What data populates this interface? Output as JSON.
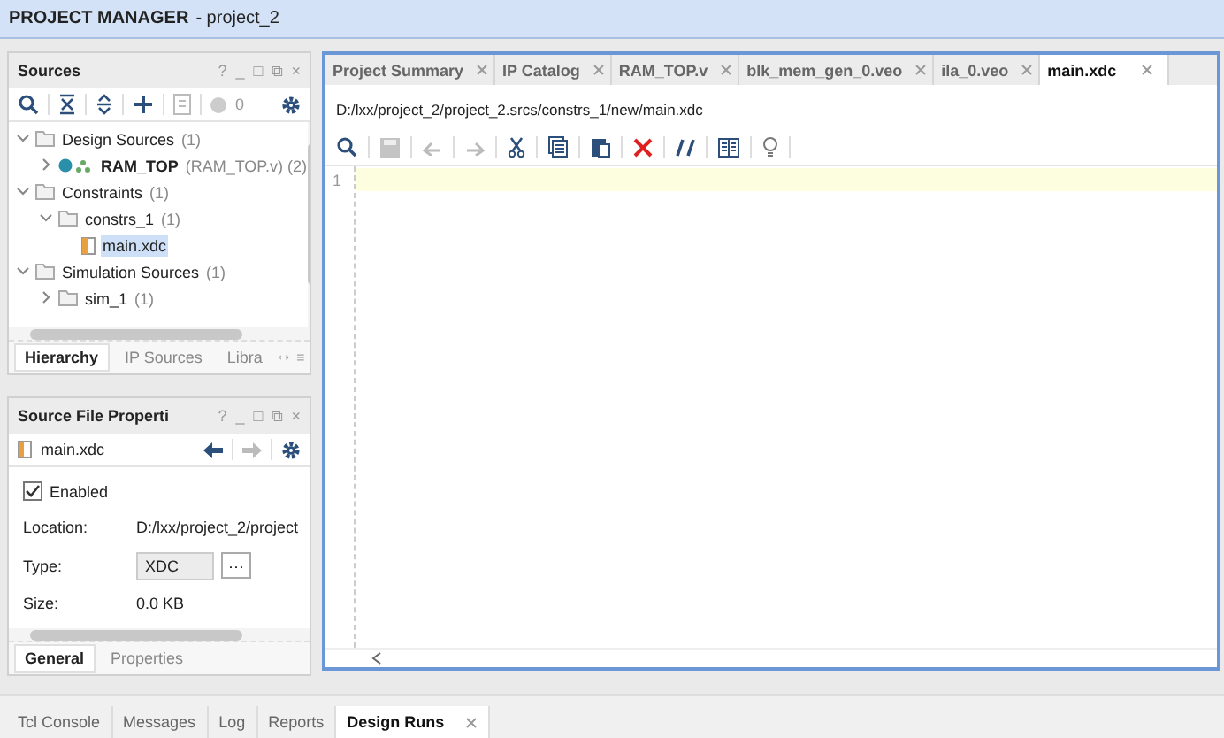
{
  "title_bar": {
    "title": "PROJECT MANAGER",
    "project": "- project_2"
  },
  "sources": {
    "title": "Sources",
    "window_controls": [
      "?",
      "_",
      "□",
      "⧉",
      "×"
    ],
    "badge": "0",
    "tree": [
      {
        "label": "Design Sources",
        "count": "(1)",
        "kind": "folder",
        "expanded": true,
        "selected": false,
        "children": [
          {
            "label": "RAM_TOP",
            "detail": "(RAM_TOP.v) (2)",
            "kind": "module",
            "expanded": false,
            "selected": false
          }
        ]
      },
      {
        "label": "Constraints",
        "count": "(1)",
        "kind": "folder",
        "expanded": true,
        "selected": false,
        "children": [
          {
            "label": "constrs_1",
            "count": "(1)",
            "kind": "folder",
            "expanded": true,
            "selected": false,
            "children": [
              {
                "label": "main.xdc",
                "kind": "file",
                "selected": true
              }
            ]
          }
        ]
      },
      {
        "label": "Simulation Sources",
        "count": "(1)",
        "kind": "folder",
        "expanded": true,
        "selected": false,
        "children": [
          {
            "label": "sim_1",
            "count": "(1)",
            "kind": "folder",
            "expanded": false,
            "selected": false
          }
        ]
      }
    ],
    "tabs": [
      {
        "label": "Hierarchy",
        "selected": true
      },
      {
        "label": "IP Sources",
        "selected": false
      },
      {
        "label": "Libra",
        "selected": false
      }
    ]
  },
  "properties": {
    "title": "Source File Properti",
    "window_controls": [
      "?",
      "_",
      "□",
      "⧉",
      "×"
    ],
    "file": "main.xdc",
    "enabled": {
      "label": "Enabled",
      "checked": true
    },
    "fields": [
      {
        "label": "Location:",
        "value": "D:/lxx/project_2/project",
        "kind": "text"
      },
      {
        "label": "Type:",
        "value": "XDC",
        "kind": "combo",
        "button": "···"
      },
      {
        "label": "Size:",
        "value": "0.0 KB",
        "kind": "text"
      }
    ],
    "tabs": [
      {
        "label": "General",
        "selected": true
      },
      {
        "label": "Properties",
        "selected": false
      }
    ]
  },
  "editor": {
    "tabs": [
      {
        "label": "Project Summary",
        "selected": false
      },
      {
        "label": "IP Catalog",
        "selected": false
      },
      {
        "label": "RAM_TOP.v",
        "selected": false
      },
      {
        "label": "blk_mem_gen_0.veo",
        "selected": false
      },
      {
        "label": "ila_0.veo",
        "selected": false
      },
      {
        "label": "main.xdc",
        "selected": true
      }
    ],
    "path": "D:/lxx/project_2/project_2.srcs/constrs_1/new/main.xdc",
    "line_numbers": [
      "1"
    ]
  },
  "bottom_tabs": [
    {
      "label": "Tcl Console",
      "selected": false,
      "closable": false
    },
    {
      "label": "Messages",
      "selected": false,
      "closable": false
    },
    {
      "label": "Log",
      "selected": false,
      "closable": false
    },
    {
      "label": "Reports",
      "selected": false,
      "closable": false
    },
    {
      "label": "Design Runs",
      "selected": true,
      "closable": true
    }
  ]
}
